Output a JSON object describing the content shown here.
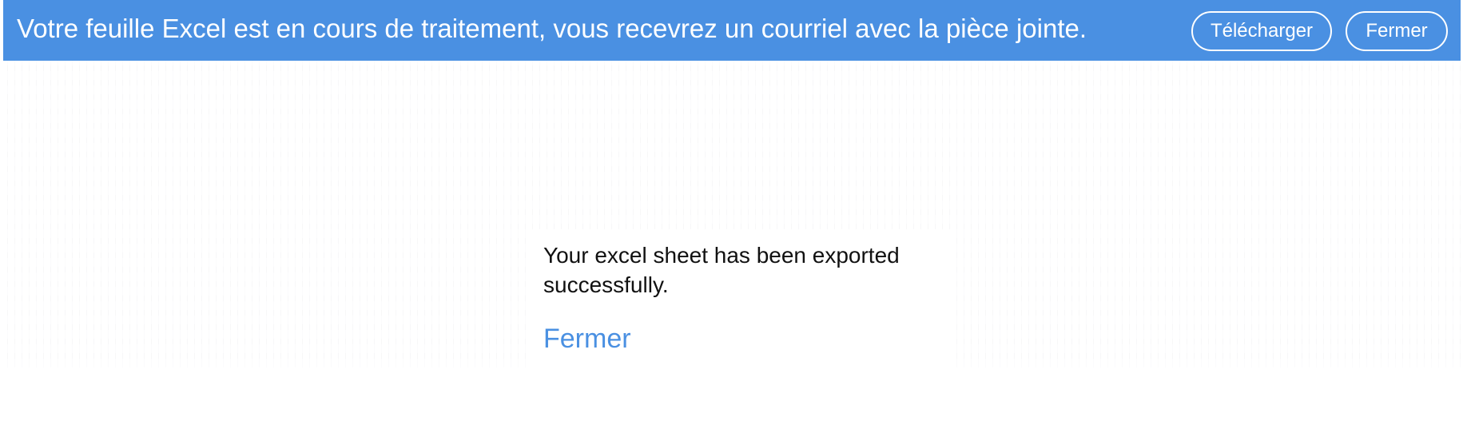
{
  "banner": {
    "message": "Votre feuille Excel est en cours de traitement, vous recevrez un courriel avec la pièce jointe.",
    "download_label": "Télécharger",
    "close_label": "Fermer",
    "background_color": "#4a90e2"
  },
  "dialog": {
    "message": "Your excel sheet has been exported successfully.",
    "close_label": "Fermer",
    "link_color": "#4a90e2"
  }
}
